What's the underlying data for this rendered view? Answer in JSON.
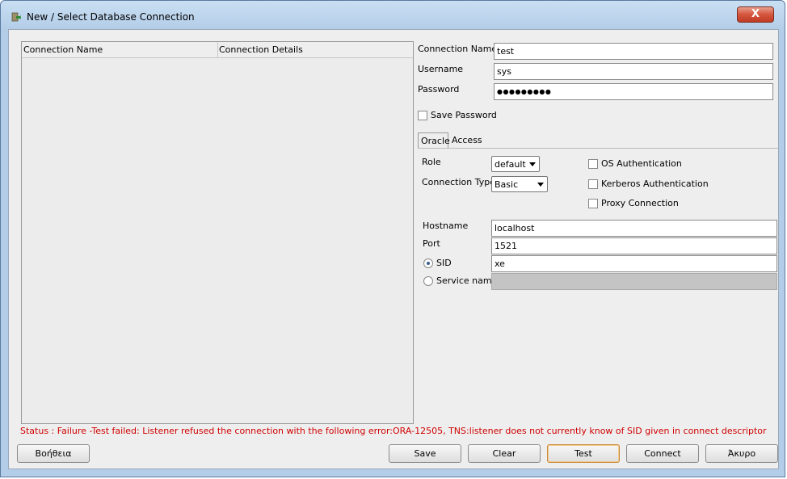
{
  "window": {
    "title": "New / Select Database Connection",
    "close_label": "X"
  },
  "table": {
    "columns": [
      "Connection Name",
      "Connection Details"
    ]
  },
  "form": {
    "connection_name_label": "Connection Name",
    "connection_name_value": "test",
    "username_label": "Username",
    "username_value": "sys",
    "password_label": "Password",
    "password_value": "●●●●●●●●●",
    "save_password_label": "Save Password"
  },
  "tabs": {
    "oracle": "Oracle",
    "access": "Access"
  },
  "oracle": {
    "role_label": "Role",
    "role_value": "default",
    "connection_type_label": "Connection Type",
    "connection_type_value": "Basic",
    "os_auth_label": "OS Authentication",
    "kerberos_label": "Kerberos Authentication",
    "proxy_label": "Proxy Connection",
    "hostname_label": "Hostname",
    "hostname_value": "localhost",
    "port_label": "Port",
    "port_value": "1521",
    "sid_label": "SID",
    "sid_value": "xe",
    "service_label": "Service name"
  },
  "status": "Status : Failure -Test failed: Listener refused the connection with the following error:ORA-12505, TNS:listener does not currently know of SID given in connect descriptor",
  "buttons": {
    "help": "Βοήθεια",
    "save": "Save",
    "clear": "Clear",
    "test": "Test",
    "connect": "Connect",
    "cancel": "Άκυρο"
  },
  "colors": {
    "status_error": "#d00000",
    "title_gradient": "#b3cde8"
  }
}
